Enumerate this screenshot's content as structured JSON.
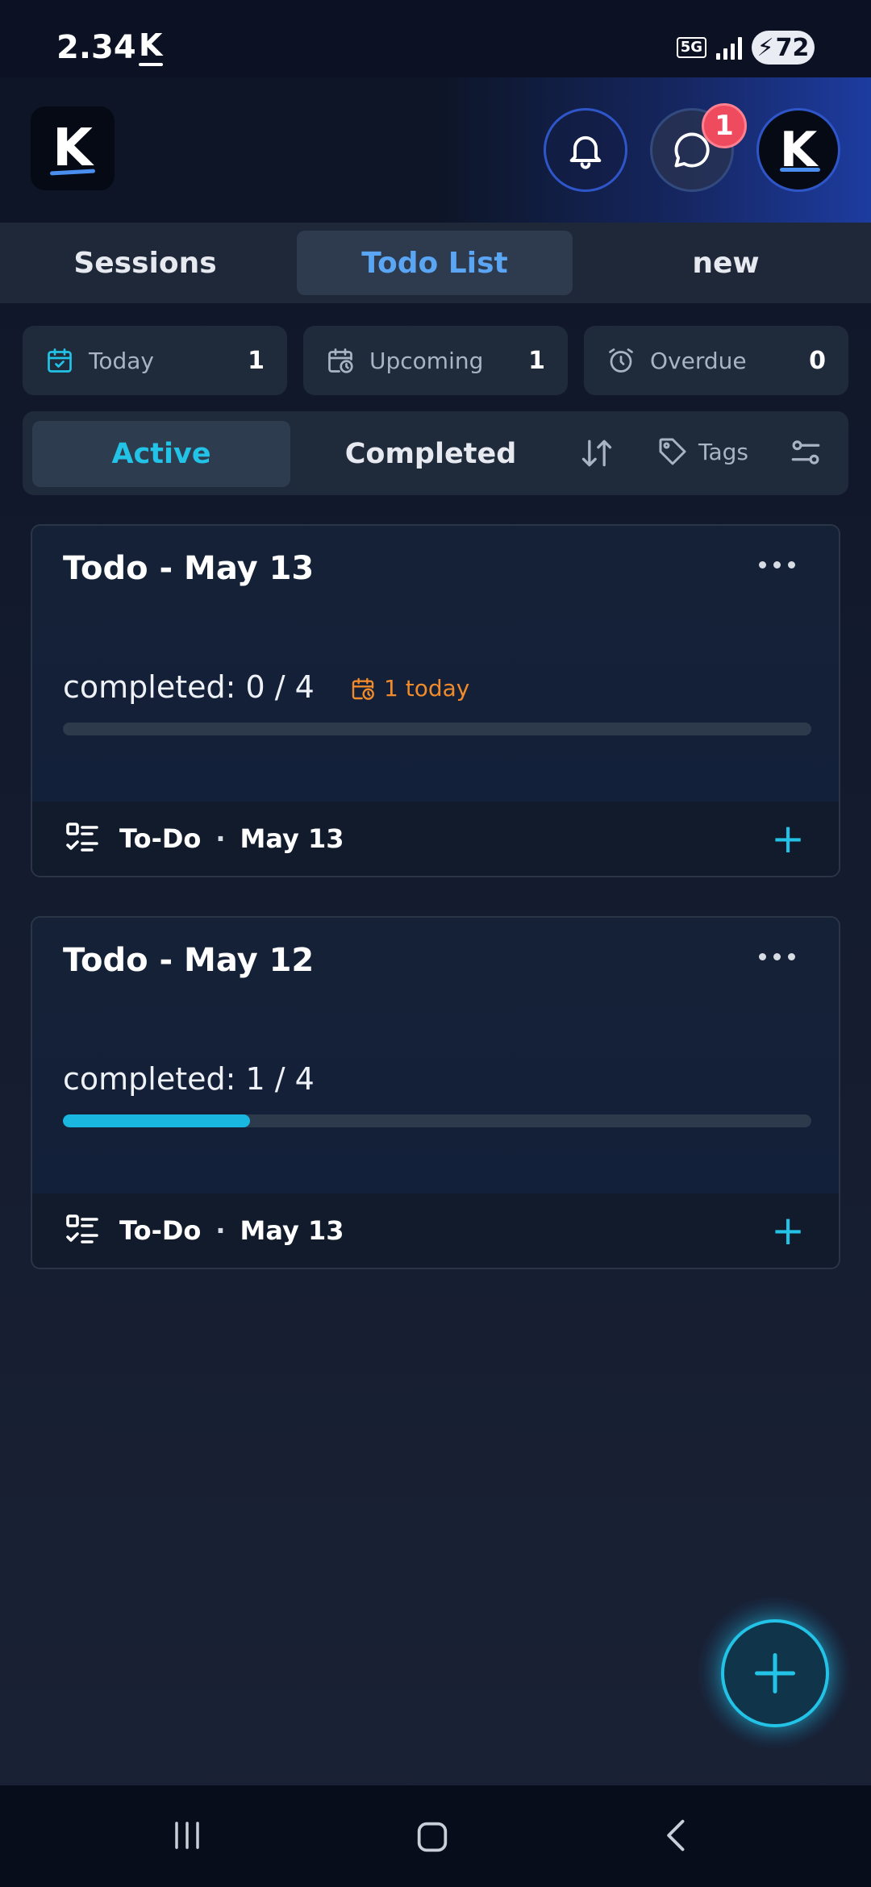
{
  "status_bar": {
    "time": "2.34",
    "app_indicator": "K",
    "network": "5G",
    "battery": "72"
  },
  "header": {
    "logo_letter": "K",
    "avatar_letter": "K",
    "chat_badge": "1",
    "accent_color": "#2f56c9"
  },
  "top_tabs": [
    {
      "label": "Sessions"
    },
    {
      "label": "Todo List"
    },
    {
      "label": "new"
    }
  ],
  "stats": [
    {
      "label": "Today",
      "count": "1",
      "icon": "calendar-check-icon"
    },
    {
      "label": "Upcoming",
      "count": "1",
      "icon": "calendar-clock-icon"
    },
    {
      "label": "Overdue",
      "count": "0",
      "icon": "alarm-icon"
    }
  ],
  "filters": {
    "active_label": "Active",
    "completed_label": "Completed",
    "tags_label": "Tags"
  },
  "cards": [
    {
      "title": "Todo - May 13",
      "completed": "completed: 0 / 4",
      "today": "1 today",
      "progress": 0,
      "footer_type": "To-Do",
      "footer_date": "May 13"
    },
    {
      "title": "Todo - May 12",
      "completed": "completed: 1 / 4",
      "progress": 0.25,
      "footer_type": "To-Do",
      "footer_date": "May 13"
    }
  ],
  "colors": {
    "active_accent": "#22c3e6",
    "warning": "#f08a2a",
    "tab_active_text": "#5aa6f5"
  }
}
